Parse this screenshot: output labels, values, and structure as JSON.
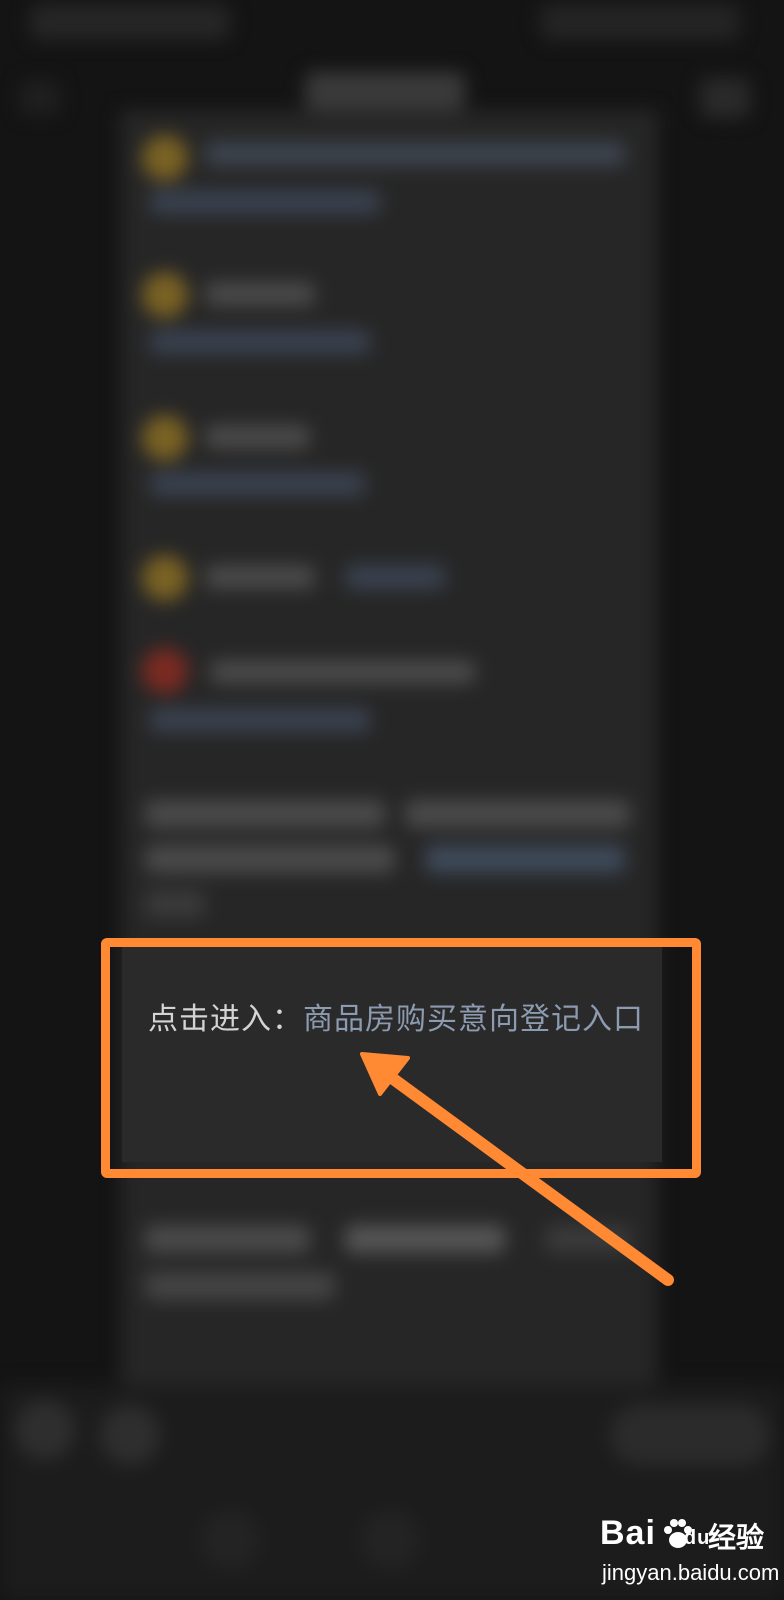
{
  "highlight": {
    "prefix": "点击进入：",
    "link": "商品房购买意向登记入口"
  },
  "watermark": {
    "brand": "Bai",
    "brand_du": "du",
    "suffix": "经验",
    "url": "jingyan.baidu.com"
  },
  "colors": {
    "background": "#141414",
    "card": "#262626",
    "highlight_frame": "#ff8a33",
    "link_text": "#8c9bb0",
    "item_icon_yellow": "#7a6224",
    "item_icon_red": "#7a2a22"
  },
  "icons": [
    "back-icon",
    "more-icon",
    "item-icon",
    "arrow-annotation-icon",
    "baidu-paw-icon"
  ]
}
